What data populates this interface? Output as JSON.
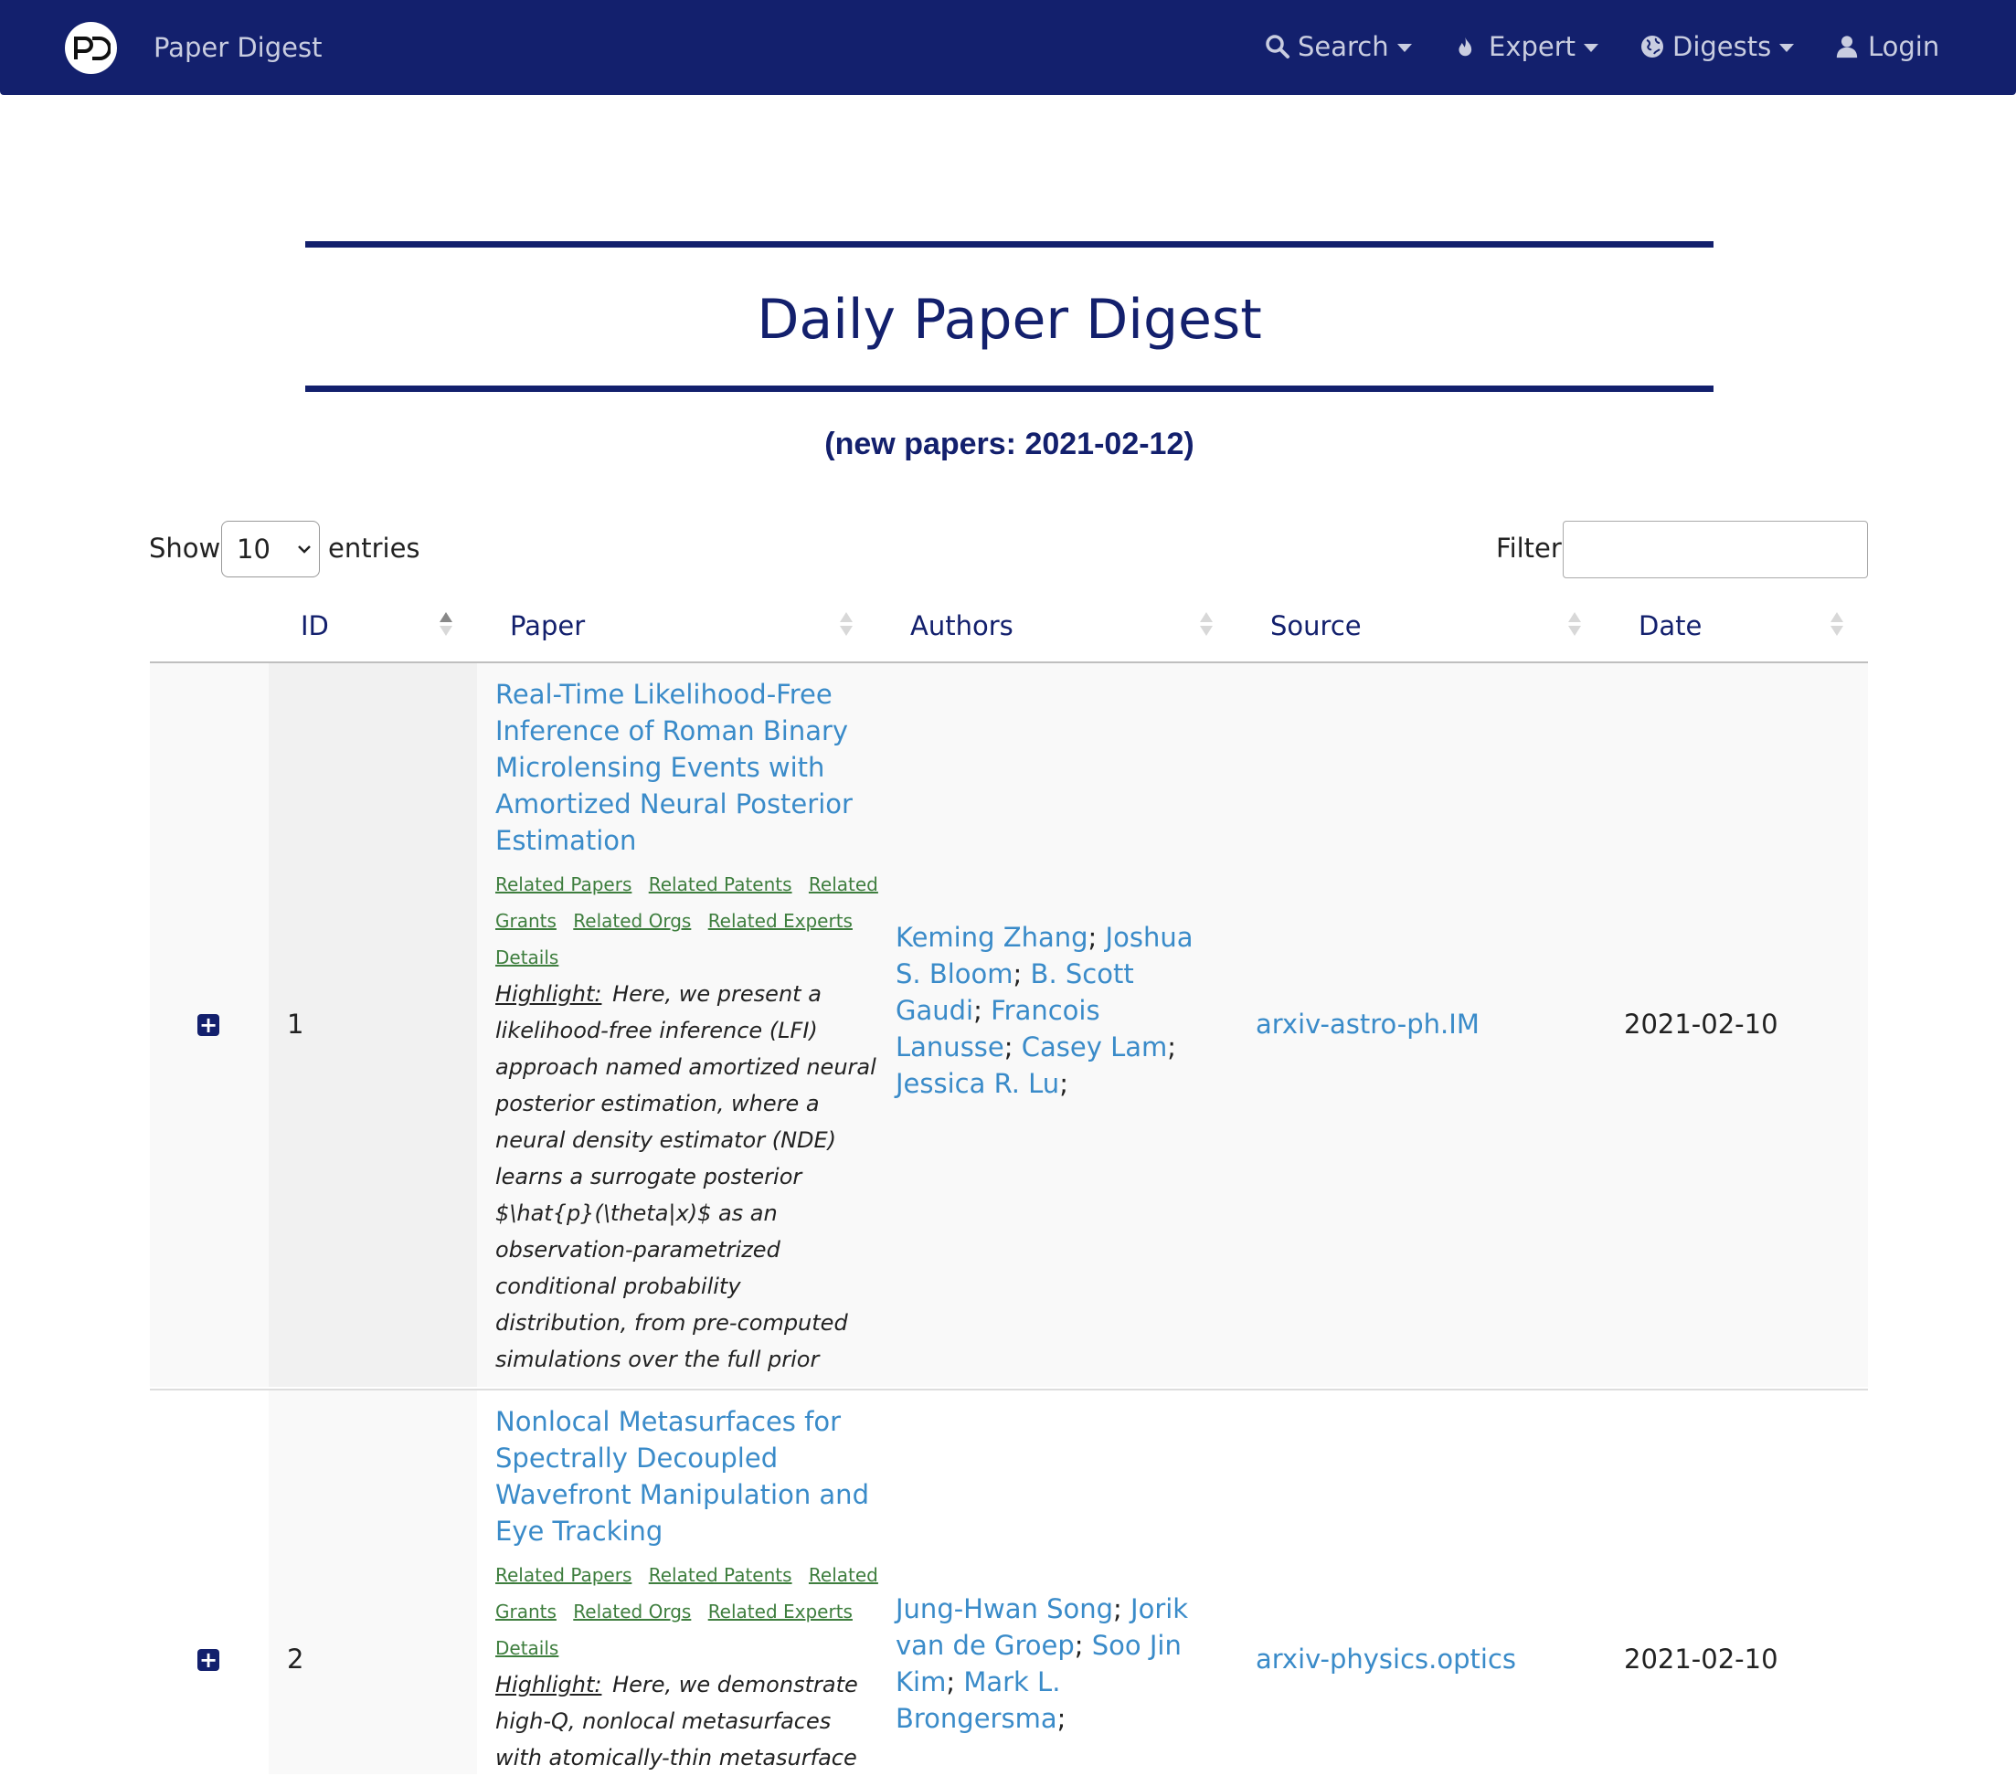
{
  "nav": {
    "brand": "Paper Digest",
    "search": "Search",
    "expert": "Expert",
    "digests": "Digests",
    "login": "Login"
  },
  "page": {
    "title": "Daily Paper Digest",
    "subtitle": "(new papers: 2021-02-12)"
  },
  "controls": {
    "show_label": "Show",
    "show_value": "10",
    "entries_label": "entries",
    "filter_label": "Filter",
    "filter_value": ""
  },
  "columns": [
    "ID",
    "Paper",
    "Authors",
    "Source",
    "Date"
  ],
  "related_links": [
    "Related Papers",
    "Related Patents",
    "Related Grants",
    "Related Orgs",
    "Related Experts",
    "Details"
  ],
  "highlight_label": "Highlight:",
  "rows": [
    {
      "id": "1",
      "title": "Real-Time Likelihood-Free Inference of Roman Binary Microlensing Events with Amortized Neural Posterior Estimation",
      "highlight": "Here, we present a likelihood-free inference (LFI) approach named amortized neural posterior estimation, where a neural density estimator (NDE) learns a surrogate posterior $\\hat{p}(\\theta|x)$ as an observation-parametrized conditional probability distribution, from pre-computed simulations over the full prior space.",
      "authors": [
        "Keming Zhang",
        "Joshua S. Bloom",
        "B. Scott Gaudi",
        "Francois Lanusse",
        "Casey Lam",
        "Jessica R. Lu"
      ],
      "source": "arxiv-astro-ph.IM",
      "date": "2021-02-10"
    },
    {
      "id": "2",
      "title": "Nonlocal Metasurfaces for Spectrally Decoupled Wavefront Manipulation and Eye Tracking",
      "highlight": "Here, we demonstrate high-Q, nonlocal metasurfaces with atomically-thin metasurface",
      "authors": [
        "Jung-Hwan Song",
        "Jorik van de Groep",
        "Soo Jin Kim",
        "Mark L. Brongersma"
      ],
      "source": "arxiv-physics.optics",
      "date": "2021-02-10"
    }
  ],
  "colors": {
    "navy": "#13206d",
    "link_blue": "#3a8bc9",
    "related_green": "#3e7e3e",
    "row_bg": "#f9f9f9",
    "sorted_col_bg": "#f1f1f1"
  }
}
